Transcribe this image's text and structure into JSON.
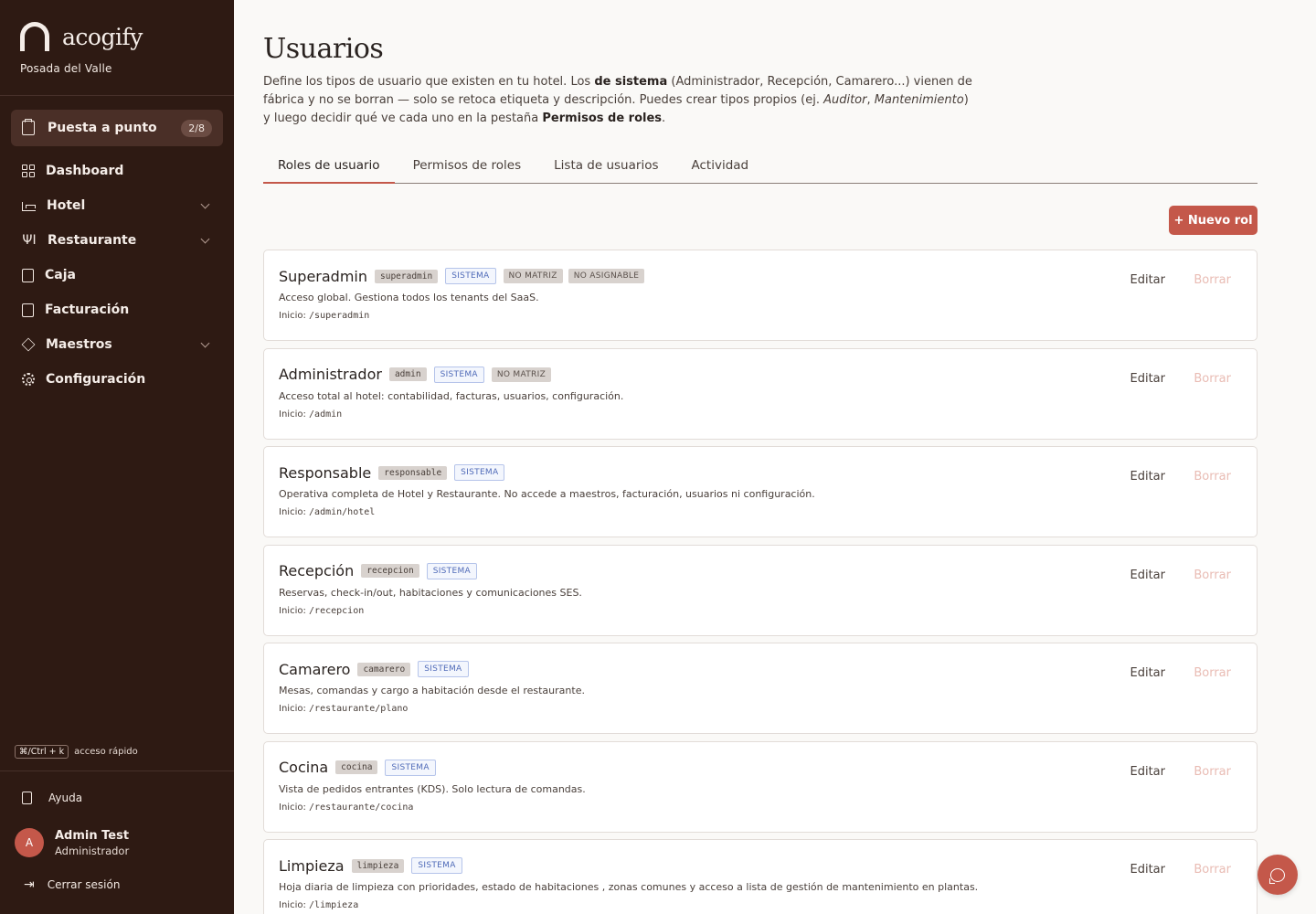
{
  "brand": {
    "name": "acogify",
    "hotel": "Posada del Valle"
  },
  "setup": {
    "label": "Puesta a punto",
    "badge": "2/8"
  },
  "nav": [
    {
      "label": "Dashboard",
      "icon": "grid-icon",
      "chevron": false
    },
    {
      "label": "Hotel",
      "icon": "bed-icon",
      "chevron": true
    },
    {
      "label": "Restaurante",
      "icon": "utensils-icon",
      "chevron": true
    },
    {
      "label": "Caja",
      "icon": "wallet-icon",
      "chevron": false
    },
    {
      "label": "Facturación",
      "icon": "receipt-icon",
      "chevron": false
    },
    {
      "label": "Maestros",
      "icon": "layers-icon",
      "chevron": true
    },
    {
      "label": "Configuración",
      "icon": "gear-icon",
      "chevron": false
    }
  ],
  "shortcut": {
    "keys": "⌘/Ctrl + k",
    "text": "acceso rápido"
  },
  "footer": {
    "help": "Ayuda",
    "user_initial": "A",
    "user_name": "Admin Test",
    "user_role": "Administrador",
    "logout": "Cerrar sesión"
  },
  "page": {
    "title": "Usuarios",
    "desc_parts": {
      "p1": "Define los tipos de usuario que existen en tu hotel. Los ",
      "b1": "de sistema",
      "p2": " (Administrador, Recepción, Camarero...) vienen de fábrica y no se borran — solo se retoca etiqueta y descripción. Puedes crear tipos propios (ej. ",
      "i1": "Auditor",
      "p3": ", ",
      "i2": "Mantenimiento",
      "p4": ") y luego decidir qué ve cada uno en la pestaña ",
      "b2": "Permisos de roles",
      "p5": "."
    },
    "tabs": [
      "Roles de usuario",
      "Permisos de roles",
      "Lista de usuarios",
      "Actividad"
    ],
    "new_role_label": "+ Nuevo rol",
    "home_prefix": "Inicio:",
    "edit_label": "Editar",
    "delete_label": "Borrar"
  },
  "roles": [
    {
      "name": "Superadmin",
      "key": "superadmin",
      "system": "SISTEMA",
      "extra": [
        "NO MATRIZ",
        "NO ASIGNABLE"
      ],
      "desc": "Acceso global. Gestiona todos los tenants del SaaS.",
      "home": "/superadmin"
    },
    {
      "name": "Administrador",
      "key": "admin",
      "system": "SISTEMA",
      "extra": [
        "NO MATRIZ"
      ],
      "desc": "Acceso total al hotel: contabilidad, facturas, usuarios, configuración.",
      "home": "/admin"
    },
    {
      "name": "Responsable",
      "key": "responsable",
      "system": "SISTEMA",
      "extra": [],
      "desc": "Operativa completa de Hotel y Restaurante. No accede a maestros, facturación, usuarios ni configuración.",
      "home": "/admin/hotel"
    },
    {
      "name": "Recepción",
      "key": "recepcion",
      "system": "SISTEMA",
      "extra": [],
      "desc": "Reservas, check-in/out, habitaciones y comunicaciones SES.",
      "home": "/recepcion"
    },
    {
      "name": "Camarero",
      "key": "camarero",
      "system": "SISTEMA",
      "extra": [],
      "desc": "Mesas, comandas y cargo a habitación desde el restaurante.",
      "home": "/restaurante/plano"
    },
    {
      "name": "Cocina",
      "key": "cocina",
      "system": "SISTEMA",
      "extra": [],
      "desc": "Vista de pedidos entrantes (KDS). Solo lectura de comandas.",
      "home": "/restaurante/cocina"
    },
    {
      "name": "Limpieza",
      "key": "limpieza",
      "system": "SISTEMA",
      "extra": [],
      "desc": "Hoja diaria de limpieza con prioridades, estado de habitaciones , zonas comunes y acceso a lista de gestión de mantenimiento en plantas.",
      "home": "/limpieza"
    }
  ],
  "colors": {
    "sidebar": "#2e1a13",
    "accent": "#c4584a",
    "system_tag": "#4f6ab8"
  }
}
